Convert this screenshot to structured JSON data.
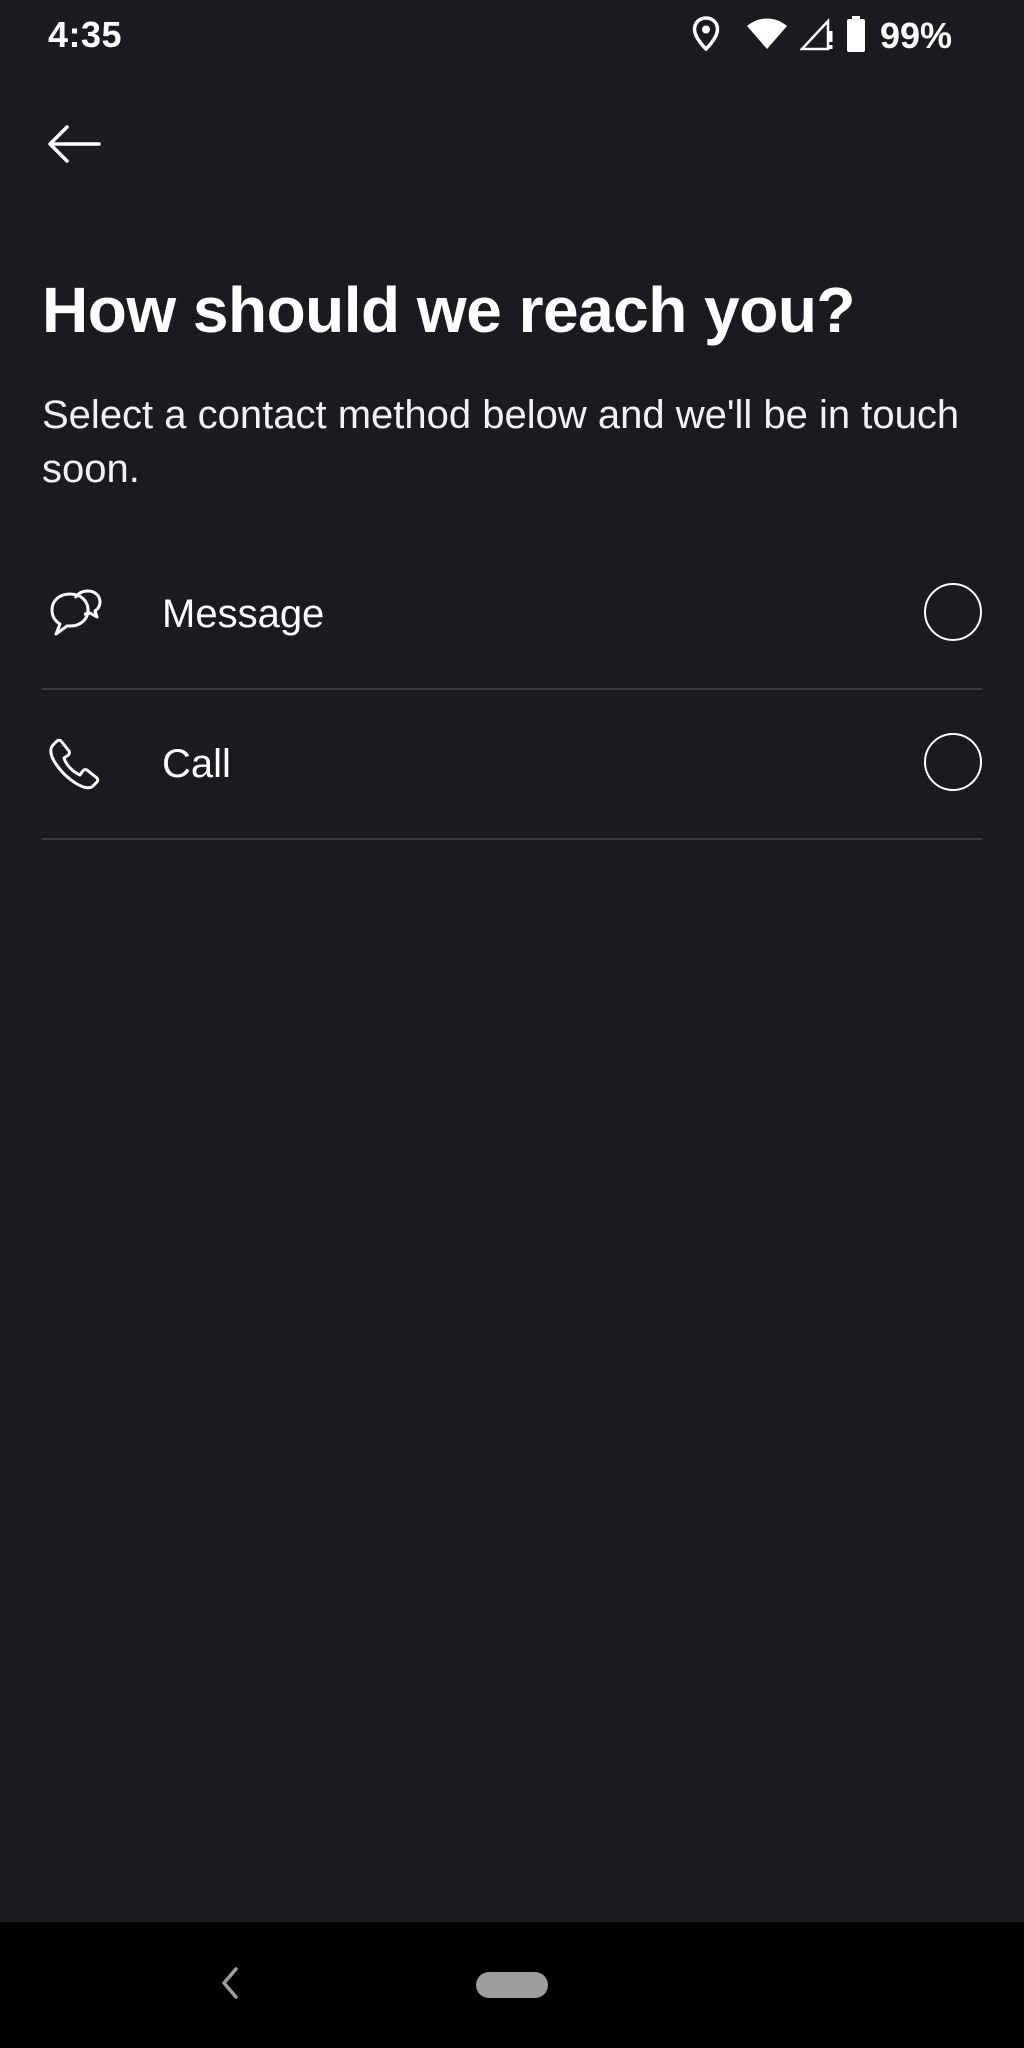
{
  "status_bar": {
    "time": "4:35",
    "battery_percent": "99%",
    "icons": [
      "location-icon",
      "wifi-icon",
      "cell-signal-icon",
      "battery-icon"
    ]
  },
  "header": {
    "back_icon": "arrow-left-icon"
  },
  "main": {
    "title": "How should we reach you?",
    "subtitle": "Select a contact method below and we'll be in touch soon.",
    "options": [
      {
        "label": "Message",
        "icon": "chat-bubbles-icon",
        "selected": false
      },
      {
        "label": "Call",
        "icon": "phone-icon",
        "selected": false
      }
    ]
  },
  "nav_bar": {
    "back_icon": "chevron-left-icon",
    "home_icon": "home-pill-icon"
  },
  "colors": {
    "background": "#1a1b21",
    "text": "#ffffff",
    "divider": "#3a3b41",
    "nav_background": "#000000"
  }
}
